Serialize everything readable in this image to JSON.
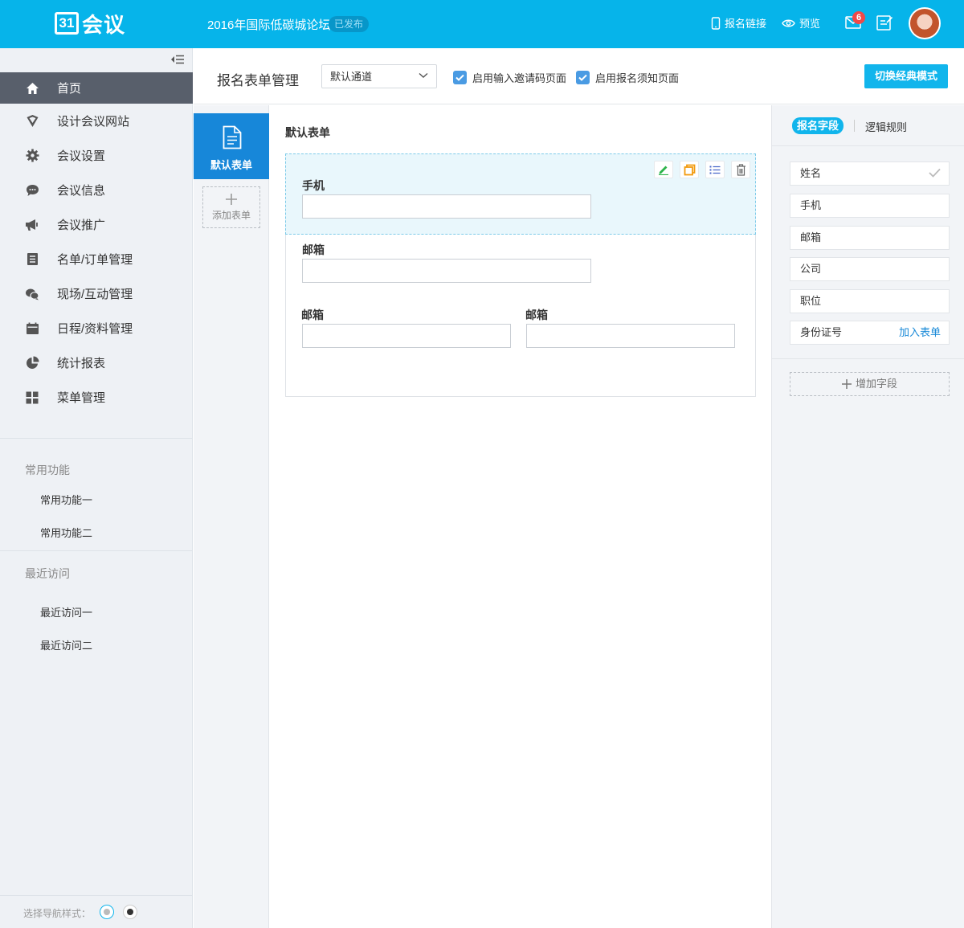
{
  "header": {
    "logo_num": "31",
    "logo_text": "会议",
    "event_title": "2016年国际低碳城论坛",
    "status": "已发布",
    "reg_link_label": "报名链接",
    "preview_label": "预览",
    "mail_count": "6",
    "accent_color": "#06b4ea"
  },
  "sidebar": {
    "items": [
      {
        "label": "首页",
        "icon": "home-icon"
      },
      {
        "label": "设计会议网站",
        "icon": "design-icon"
      },
      {
        "label": "会议设置",
        "icon": "gear-icon"
      },
      {
        "label": "会议信息",
        "icon": "chat-icon"
      },
      {
        "label": "会议推广",
        "icon": "megaphone-icon"
      },
      {
        "label": "名单/订单管理",
        "icon": "list-icon"
      },
      {
        "label": "现场/互动管理",
        "icon": "interact-icon"
      },
      {
        "label": "日程/资料管理",
        "icon": "calendar-icon"
      },
      {
        "label": "统计报表",
        "icon": "pie-chart-icon"
      },
      {
        "label": "菜单管理",
        "icon": "grid-icon"
      }
    ],
    "common_title": "常用功能",
    "common_items": [
      "常用功能一",
      "常用功能二"
    ],
    "recent_title": "最近访问",
    "recent_items": [
      "最近访问一",
      "最近访问二"
    ],
    "nav_style_label": "选择导航样式："
  },
  "toolbar": {
    "title": "报名表单管理",
    "channel_select": "默认通道",
    "check_invite": "启用输入邀请码页面",
    "check_notice": "启用报名须知页面",
    "switch_button": "切换经典模式"
  },
  "forms": {
    "default_form": "默认表单",
    "add_form": "添加表单"
  },
  "canvas": {
    "title": "默认表单",
    "fields": [
      {
        "label": "手机"
      },
      {
        "label": "邮箱"
      },
      {
        "label": "邮箱"
      },
      {
        "label": "邮箱"
      }
    ]
  },
  "right_panel": {
    "tab_active": "报名字段",
    "tab_other": "逻辑规则",
    "fields": [
      "姓名",
      "手机",
      "邮箱",
      "公司",
      "职位",
      "身份证号"
    ],
    "join_label": "加入表单",
    "add_field": "增加字段"
  }
}
